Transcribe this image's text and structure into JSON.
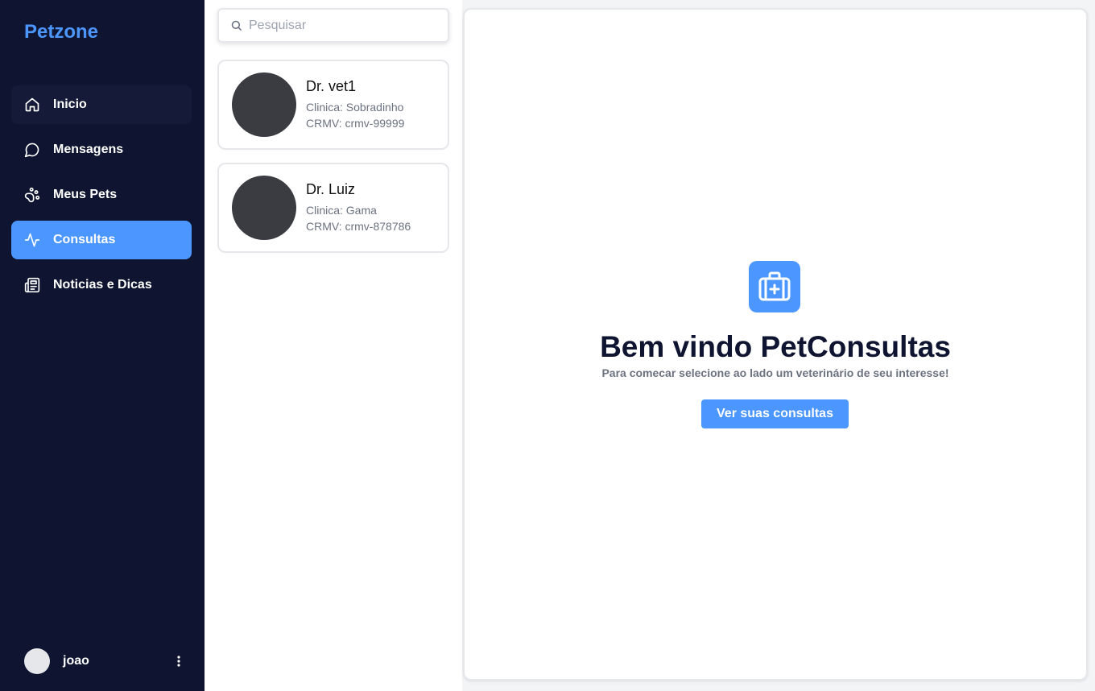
{
  "app": {
    "brand": "Petzone"
  },
  "sidebar": {
    "items": [
      {
        "label": "Inicio",
        "icon": "home-icon"
      },
      {
        "label": "Mensagens",
        "icon": "chat-bubble-icon"
      },
      {
        "label": "Meus Pets",
        "icon": "paw-icon"
      },
      {
        "label": "Consultas",
        "icon": "activity-icon",
        "active": true
      },
      {
        "label": "Noticias e Dicas",
        "icon": "newspaper-icon"
      }
    ],
    "user": {
      "name": "joao",
      "menu_icon": "kebab-menu-icon"
    }
  },
  "search": {
    "placeholder": "Pesquisar",
    "value": ""
  },
  "vets": [
    {
      "name": "Dr. vet1",
      "clinic": "Clinica: Sobradinho",
      "crmv": "CRMV: crmv-99999"
    },
    {
      "name": "Dr. Luiz",
      "clinic": "Clinica: Gama",
      "crmv": "CRMV: crmv-878786"
    }
  ],
  "welcome": {
    "icon": "medical-kit-icon",
    "title": "Bem vindo PetConsultas",
    "subtitle": "Para comecar selecione ao lado um veterinário de seu interesse!",
    "button_label": "Ver suas consultas"
  },
  "colors": {
    "sidebar_bg": "#0f1431",
    "accent": "#4c97ff",
    "avatar_placeholder": "#3b3c41"
  }
}
